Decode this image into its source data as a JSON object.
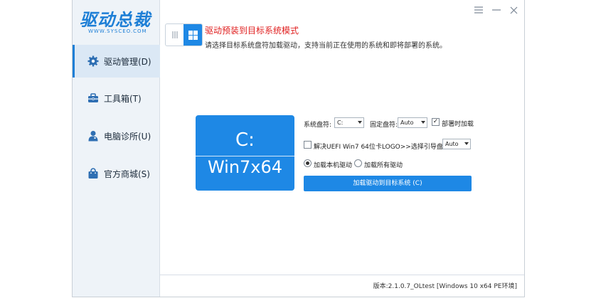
{
  "app": {
    "logo_text": "驱动总裁",
    "logo_sub": "WWW.SYSCEO.COM"
  },
  "window_controls": {
    "menu_icon": "menu-icon",
    "minimize_icon": "minimize-icon",
    "close_icon": "close-icon"
  },
  "sidebar": {
    "items": [
      {
        "label": "驱动管理(D)",
        "icon": "gear-icon",
        "active": true
      },
      {
        "label": "工具箱(T)",
        "icon": "toolbox-icon",
        "active": false
      },
      {
        "label": "电脑诊所(U)",
        "icon": "person-icon",
        "active": false
      },
      {
        "label": "官方商城(S)",
        "icon": "shop-bag-icon",
        "active": false
      }
    ]
  },
  "mode": {
    "title": "驱动预装到目标系统模式",
    "description": "请选择目标系统盘符加载驱动，支持当前正在使用的系统和即将部署的系统。"
  },
  "drive_card": {
    "letter": "C:",
    "os": "Win7x64"
  },
  "options": {
    "system_drive_label": "系统盘符:",
    "system_drive_value": "C:",
    "fixed_drive_label": "固定盘符:",
    "fixed_drive_value": "Auto",
    "load_on_deploy_label": "部署时加载",
    "load_on_deploy_checked": true,
    "uefi_fix_label": "解决UEFI Win7 64位卡LOGO>>选择引导盘符:",
    "uefi_fix_checked": false,
    "uefi_boot_value": "Auto",
    "radio_local_label": "加载本机驱动",
    "radio_all_label": "加载所有驱动",
    "selected_radio": "local",
    "load_button_label": "加载驱动到目标系统 (C)"
  },
  "status": {
    "version": "版本:2.1.0.7_OLtest [Windows 10 x64 PE环境]"
  },
  "colors": {
    "accent": "#1e88e5",
    "mode_title": "#e02020",
    "sidebar_bg": "#eef3f8"
  }
}
